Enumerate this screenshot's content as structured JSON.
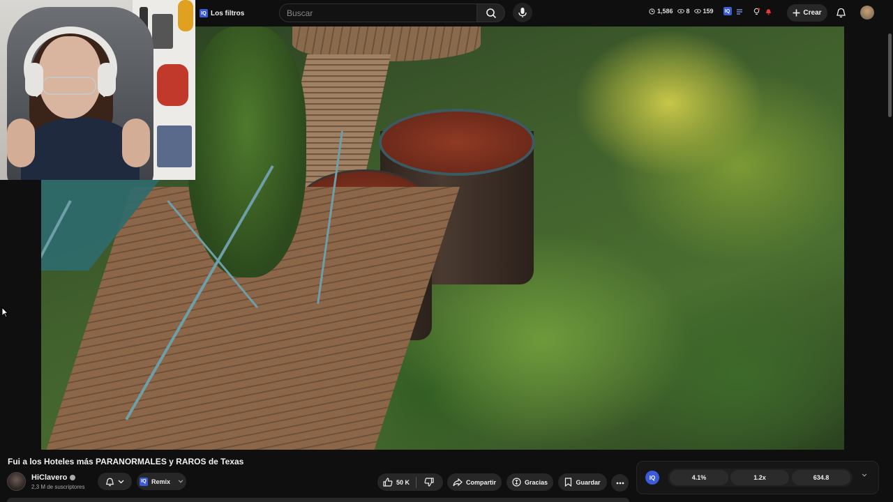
{
  "topbar": {
    "filters_label": "Los filtros",
    "search_placeholder": "Buscar",
    "stats": {
      "time": "1,586",
      "views_a": "8",
      "views_b": "159"
    },
    "create_label": "Crear"
  },
  "video": {
    "title": "Fui a los Hoteles más PARANORMALES y RAROS de Texas"
  },
  "channel": {
    "name": "HiClavero",
    "subscribers": "2,3 M de suscriptores"
  },
  "actions": {
    "remix_label": "Remix",
    "likes": "50 K",
    "share_label": "Compartir",
    "thanks_label": "Gracias",
    "save_label": "Guardar"
  },
  "iq_panel": {
    "logo": "IQ",
    "stat_1": "4.1%",
    "stat_2": "1.2x",
    "stat_3": "634.8"
  },
  "colors": {
    "background": "#0f0f0f",
    "pill": "#272727",
    "iq_accent": "#3b5bdb"
  },
  "icons": [
    "search-icon",
    "mic-icon",
    "clock-icon",
    "eye-icon",
    "plus-icon",
    "bell-icon",
    "thumb-up-icon",
    "thumb-down-icon",
    "share-icon",
    "thanks-icon",
    "save-icon",
    "more-icon",
    "chevron-down-icon"
  ]
}
